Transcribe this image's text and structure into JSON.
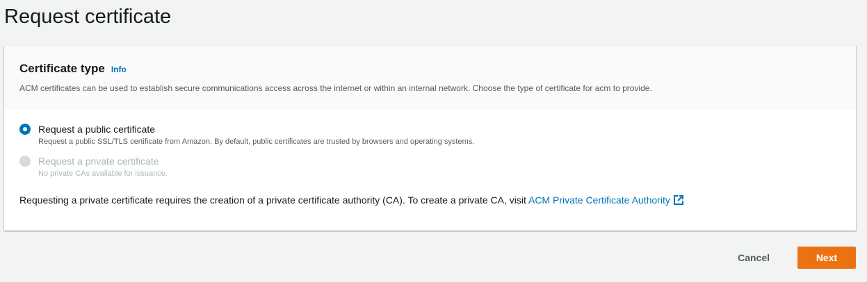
{
  "page": {
    "title": "Request certificate"
  },
  "certificate_type": {
    "title": "Certificate type",
    "info_label": "Info",
    "description": "ACM certificates can be used to establish secure communications access across the internet or within an internal network. Choose the type of certificate for acm to provide.",
    "options": [
      {
        "label": "Request a public certificate",
        "description": "Request a public SSL/TLS certificate from Amazon. By default, public certificates are trusted by browsers and operating systems.",
        "selected": true,
        "disabled": false
      },
      {
        "label": "Request a private certificate",
        "description": "No private CAs available for issuance.",
        "selected": false,
        "disabled": true
      }
    ],
    "note_text": "Requesting a private certificate requires the creation of a private certificate authority (CA). To create a private CA, visit ",
    "note_link": "ACM Private Certificate Authority",
    "note_link_icon": "external-link-icon"
  },
  "actions": {
    "cancel_label": "Cancel",
    "next_label": "Next"
  },
  "colors": {
    "accent": "#0073bb",
    "primary_button": "#ec7211",
    "background": "#f2f3f3"
  }
}
